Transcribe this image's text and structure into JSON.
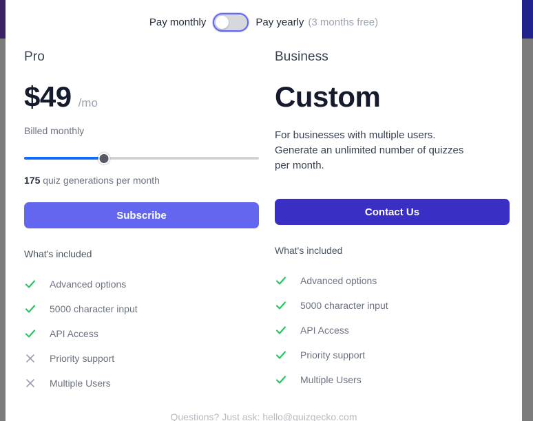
{
  "billing": {
    "monthly_label": "Pay monthly",
    "yearly_label": "Pay yearly",
    "yearly_note": "(3 months free)",
    "toggle_state": "monthly",
    "accent_ring": "#6366f1"
  },
  "plans": [
    {
      "name": "Pro",
      "price_amount": "$49",
      "price_period": "/mo",
      "billed_note": "Billed monthly",
      "slider": {
        "value_percent": 34,
        "fill_color": "#0d6efd",
        "caption_value": "175",
        "caption_text": " quiz generations per month"
      },
      "cta_label": "Subscribe",
      "cta_color": "#6366ef",
      "included_title": "What's included",
      "features": [
        {
          "label": "Advanced options",
          "icon": "check-icon",
          "included": true
        },
        {
          "label": "5000 character input",
          "icon": "check-icon",
          "included": true
        },
        {
          "label": "API Access",
          "icon": "check-icon",
          "included": true
        },
        {
          "label": "Priority support",
          "icon": "cross-icon",
          "included": false
        },
        {
          "label": "Multiple Users",
          "icon": "cross-icon",
          "included": false
        }
      ]
    },
    {
      "name": "Business",
      "price_amount": "Custom",
      "description": "For businesses with multiple users. Generate an unlimited number of quizzes per month.",
      "cta_label": "Contact Us",
      "cta_color": "#3a2fc4",
      "included_title": "What's included",
      "features": [
        {
          "label": "Advanced options",
          "icon": "check-icon",
          "included": true
        },
        {
          "label": "5000 character input",
          "icon": "check-icon",
          "included": true
        },
        {
          "label": "API Access",
          "icon": "check-icon",
          "included": true
        },
        {
          "label": "Priority support",
          "icon": "check-icon",
          "included": true
        },
        {
          "label": "Multiple Users",
          "icon": "check-icon",
          "included": true
        }
      ]
    }
  ],
  "footer": {
    "text": "Questions? Just ask: hello@quizgecko.com"
  },
  "colors": {
    "check_green": "#22c55e",
    "cross_gray": "#9ca3af",
    "heading_dark": "#151b2d"
  }
}
